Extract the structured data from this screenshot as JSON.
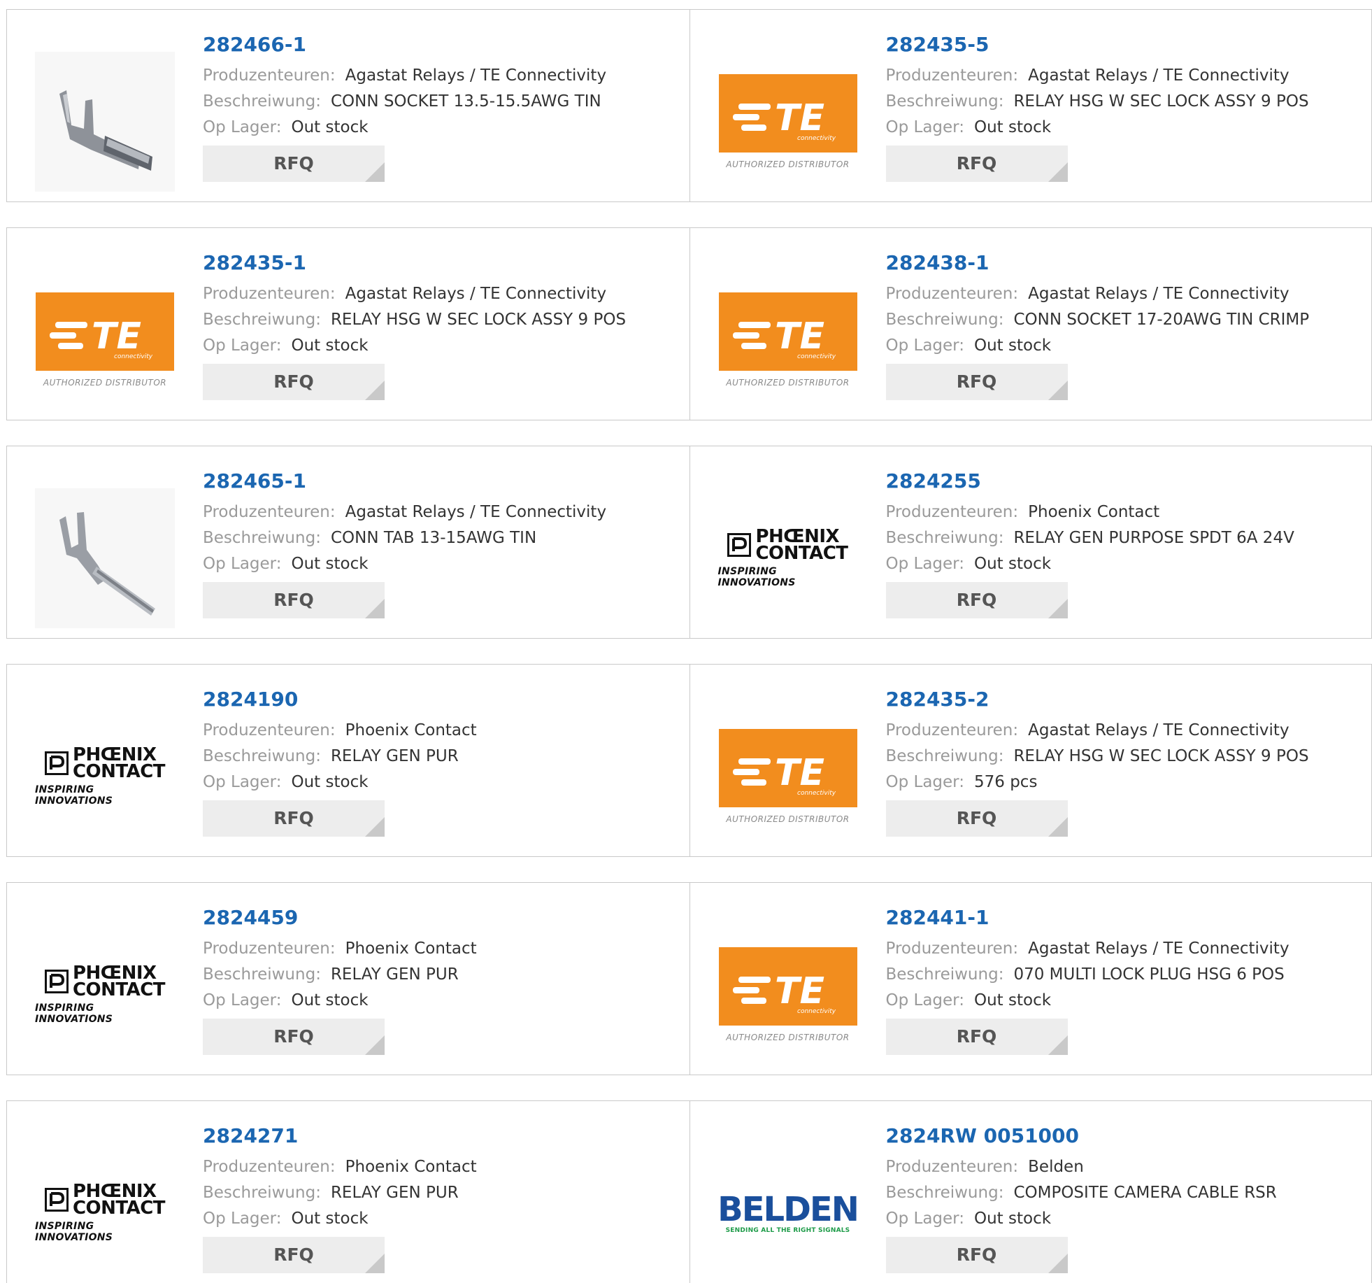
{
  "labels": {
    "manufacturer": "Produzenteuren:",
    "description": "Beschreiwung:",
    "stock": "Op Lager:",
    "rfq": "RFQ"
  },
  "logos": {
    "te": {
      "word": "TE",
      "small": "connectivity",
      "tagline": "AUTHORIZED DISTRIBUTOR"
    },
    "phoenix": {
      "line1": "PHŒNIX",
      "line2": "CONTACT",
      "tagline": "INSPIRING INNOVATIONS"
    },
    "belden": {
      "word": "BELDEN",
      "tagline": "SENDING ALL THE RIGHT SIGNALS"
    }
  },
  "colors": {
    "link": "#1b66b1",
    "te_orange": "#f28d1e",
    "belden_blue": "#1a4f9c",
    "belden_green": "#1d9b48"
  },
  "products": [
    {
      "part": "282466-1",
      "manufacturer": "Agastat Relays / TE Connectivity",
      "description": "CONN SOCKET 13.5-15.5AWG TIN",
      "stock": "Out stock",
      "image": "socket-photo"
    },
    {
      "part": "282435-5",
      "manufacturer": "Agastat Relays / TE Connectivity",
      "description": "RELAY HSG W SEC LOCK ASSY 9 POS",
      "stock": "Out stock",
      "image": "te-logo"
    },
    {
      "part": "282435-1",
      "manufacturer": "Agastat Relays / TE Connectivity",
      "description": "RELAY HSG W SEC LOCK ASSY 9 POS",
      "stock": "Out stock",
      "image": "te-logo"
    },
    {
      "part": "282438-1",
      "manufacturer": "Agastat Relays / TE Connectivity",
      "description": "CONN SOCKET 17-20AWG TIN CRIMP",
      "stock": "Out stock",
      "image": "te-logo"
    },
    {
      "part": "282465-1",
      "manufacturer": "Agastat Relays / TE Connectivity",
      "description": "CONN TAB 13-15AWG TIN",
      "stock": "Out stock",
      "image": "tab-photo"
    },
    {
      "part": "2824255",
      "manufacturer": "Phoenix Contact",
      "description": "RELAY GEN PURPOSE SPDT 6A 24V",
      "stock": "Out stock",
      "image": "phoenix-logo"
    },
    {
      "part": "2824190",
      "manufacturer": "Phoenix Contact",
      "description": "RELAY GEN PUR",
      "stock": "Out stock",
      "image": "phoenix-logo"
    },
    {
      "part": "282435-2",
      "manufacturer": "Agastat Relays / TE Connectivity",
      "description": "RELAY HSG W SEC LOCK ASSY 9 POS",
      "stock": "576 pcs",
      "image": "te-logo"
    },
    {
      "part": "2824459",
      "manufacturer": "Phoenix Contact",
      "description": "RELAY GEN PUR",
      "stock": "Out stock",
      "image": "phoenix-logo"
    },
    {
      "part": "282441-1",
      "manufacturer": "Agastat Relays / TE Connectivity",
      "description": "070 MULTI LOCK PLUG HSG 6 POS",
      "stock": "Out stock",
      "image": "te-logo"
    },
    {
      "part": "2824271",
      "manufacturer": "Phoenix Contact",
      "description": "RELAY GEN PUR",
      "stock": "Out stock",
      "image": "phoenix-logo"
    },
    {
      "part": "2824RW 0051000",
      "manufacturer": "Belden",
      "description": "COMPOSITE CAMERA CABLE RSR",
      "stock": "Out stock",
      "image": "belden-logo"
    }
  ]
}
